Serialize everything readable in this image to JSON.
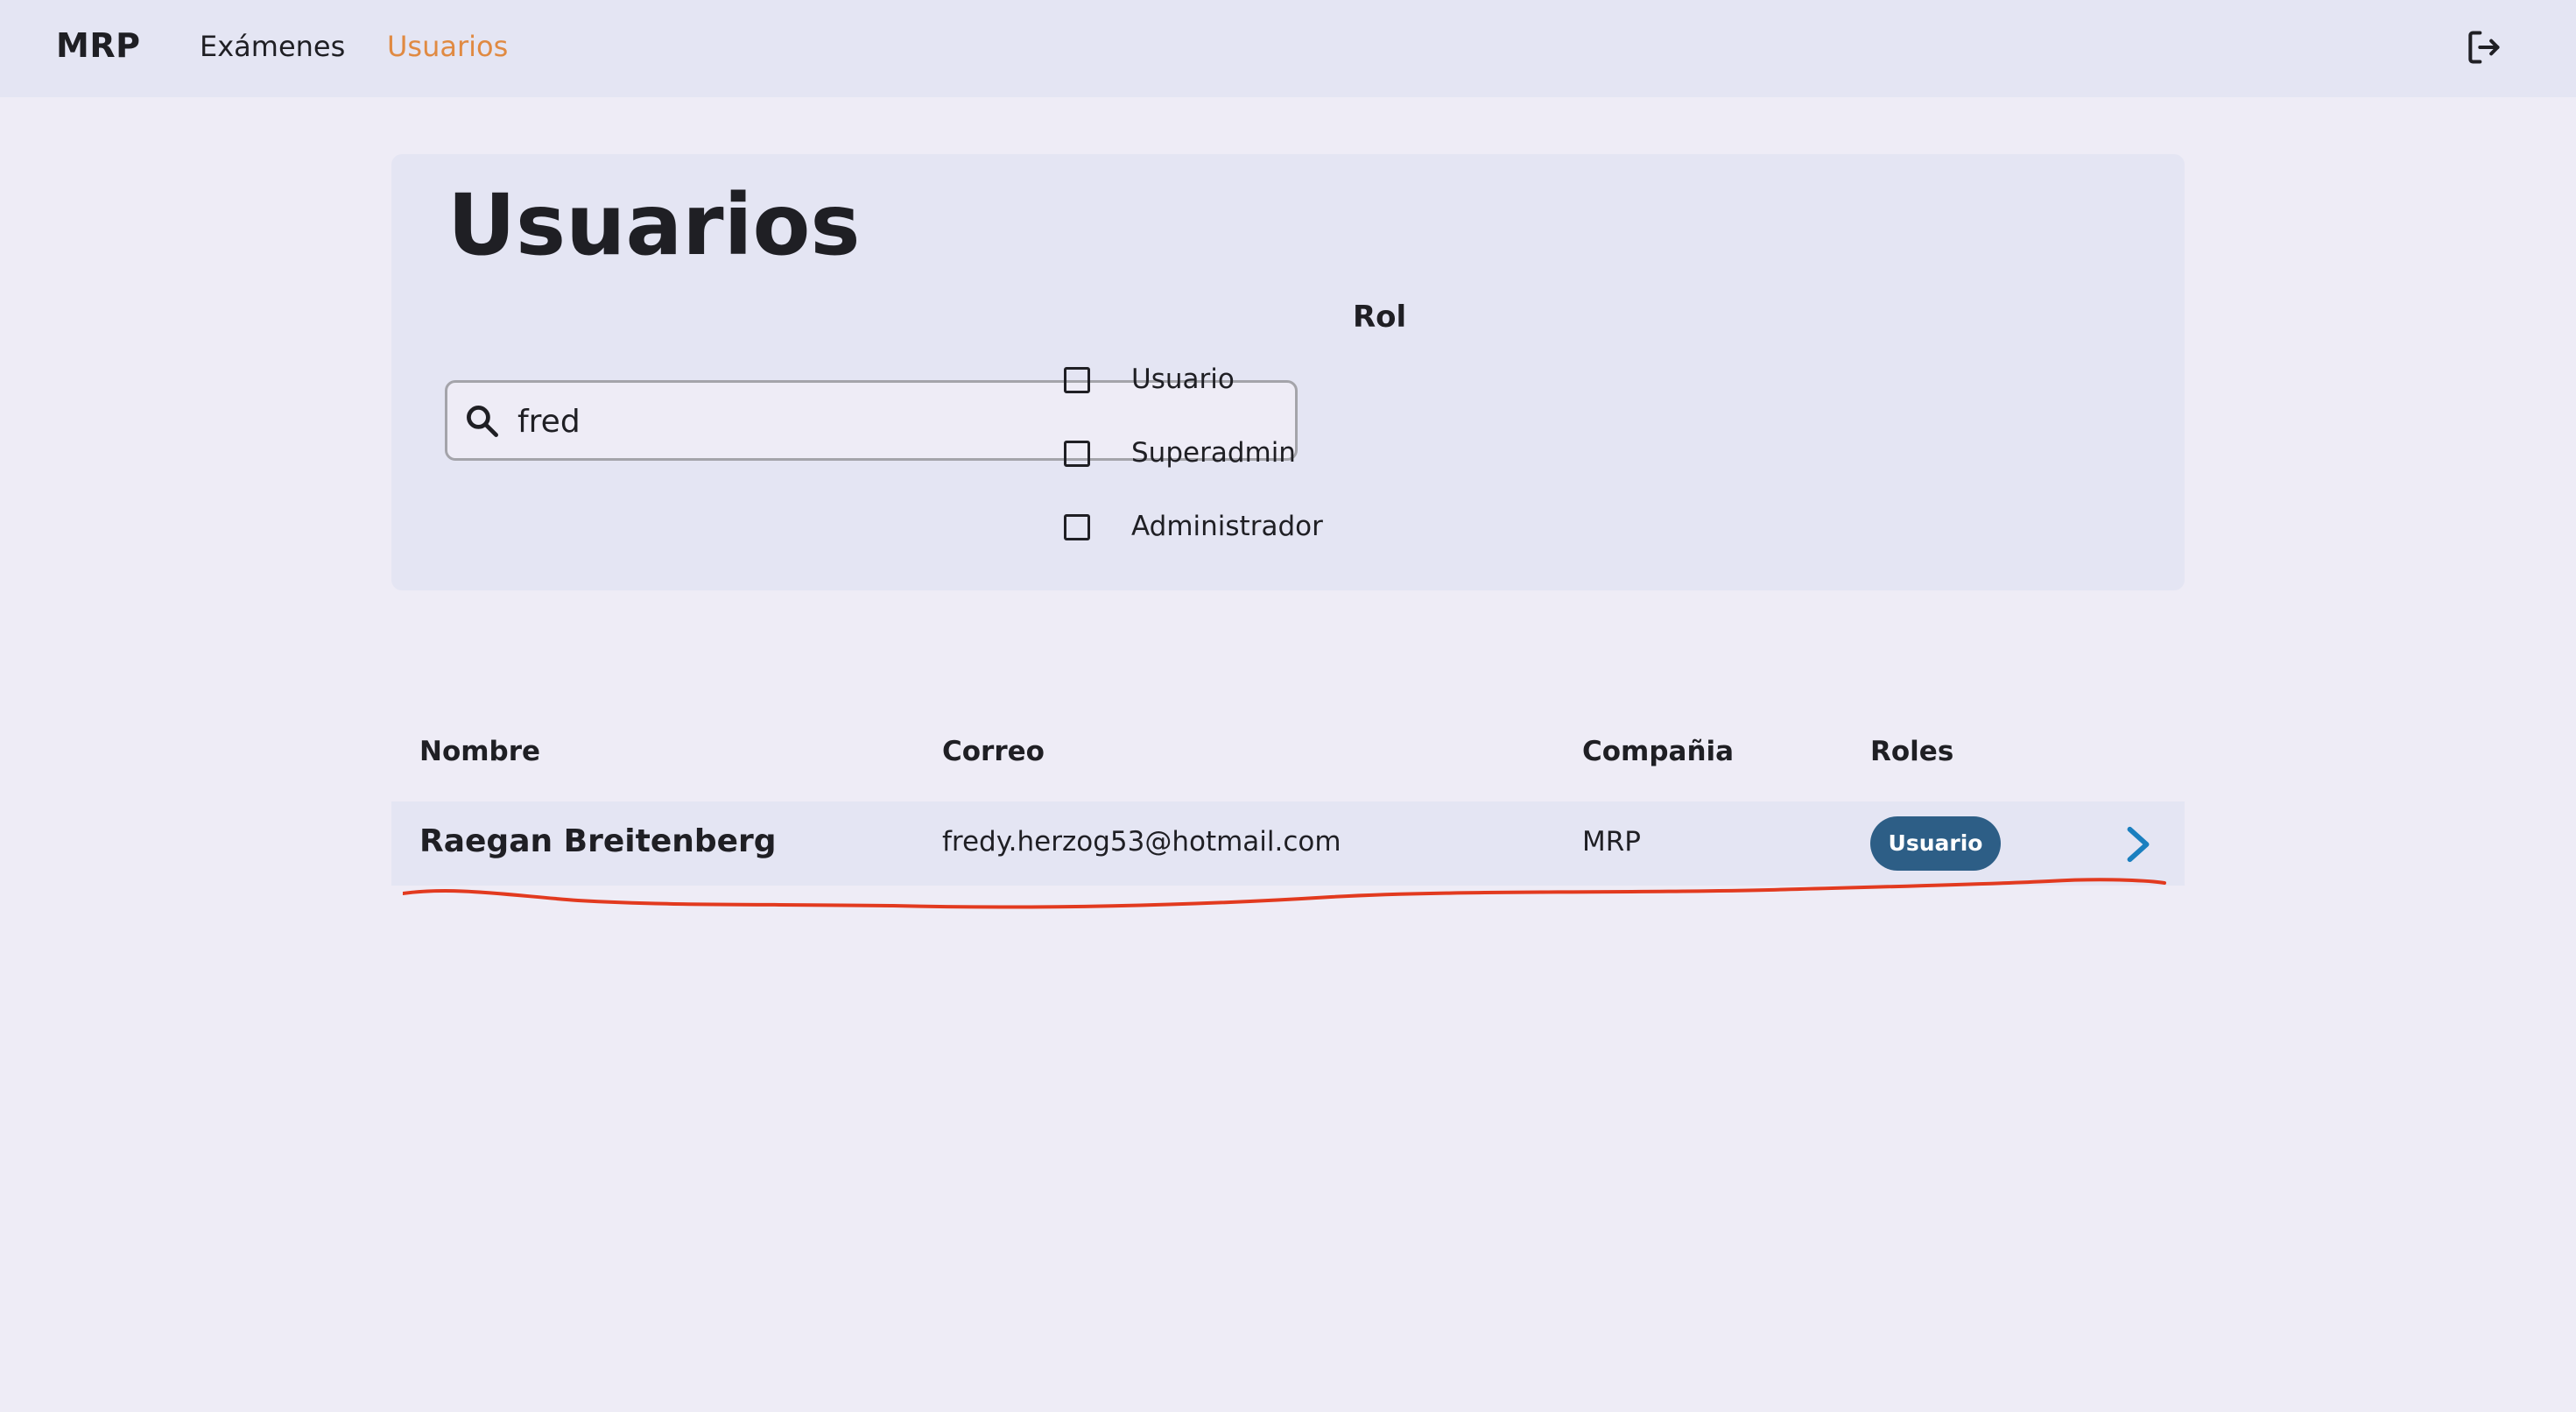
{
  "nav": {
    "brand": "MRP",
    "links": [
      {
        "label": "Exámenes",
        "active": false
      },
      {
        "label": "Usuarios",
        "active": true
      }
    ],
    "active_color": "#e08a42",
    "logout_icon": "logout-icon"
  },
  "filters": {
    "title": "Usuarios",
    "search": {
      "value": "fred",
      "icon": "search-icon"
    },
    "role_title": "Rol",
    "roles": [
      {
        "label": "Usuario",
        "checked": false
      },
      {
        "label": "Superadmin",
        "checked": false
      },
      {
        "label": "Administrador",
        "checked": false
      }
    ]
  },
  "table": {
    "headers": {
      "nombre": "Nombre",
      "correo": "Correo",
      "compania": "Compañia",
      "roles": "Roles"
    },
    "rows": [
      {
        "nombre": "Raegan Breitenberg",
        "correo": "fredy.herzog53@hotmail.com",
        "compania": "MRP",
        "rol": "Usuario",
        "icon": "chevron-right-icon"
      }
    ]
  },
  "colors": {
    "background": "#eeecf6",
    "panel": "#e4e5f3",
    "badge": "#2d5e86",
    "chevron": "#1a7fbf",
    "annotation": "#e23a1f"
  }
}
